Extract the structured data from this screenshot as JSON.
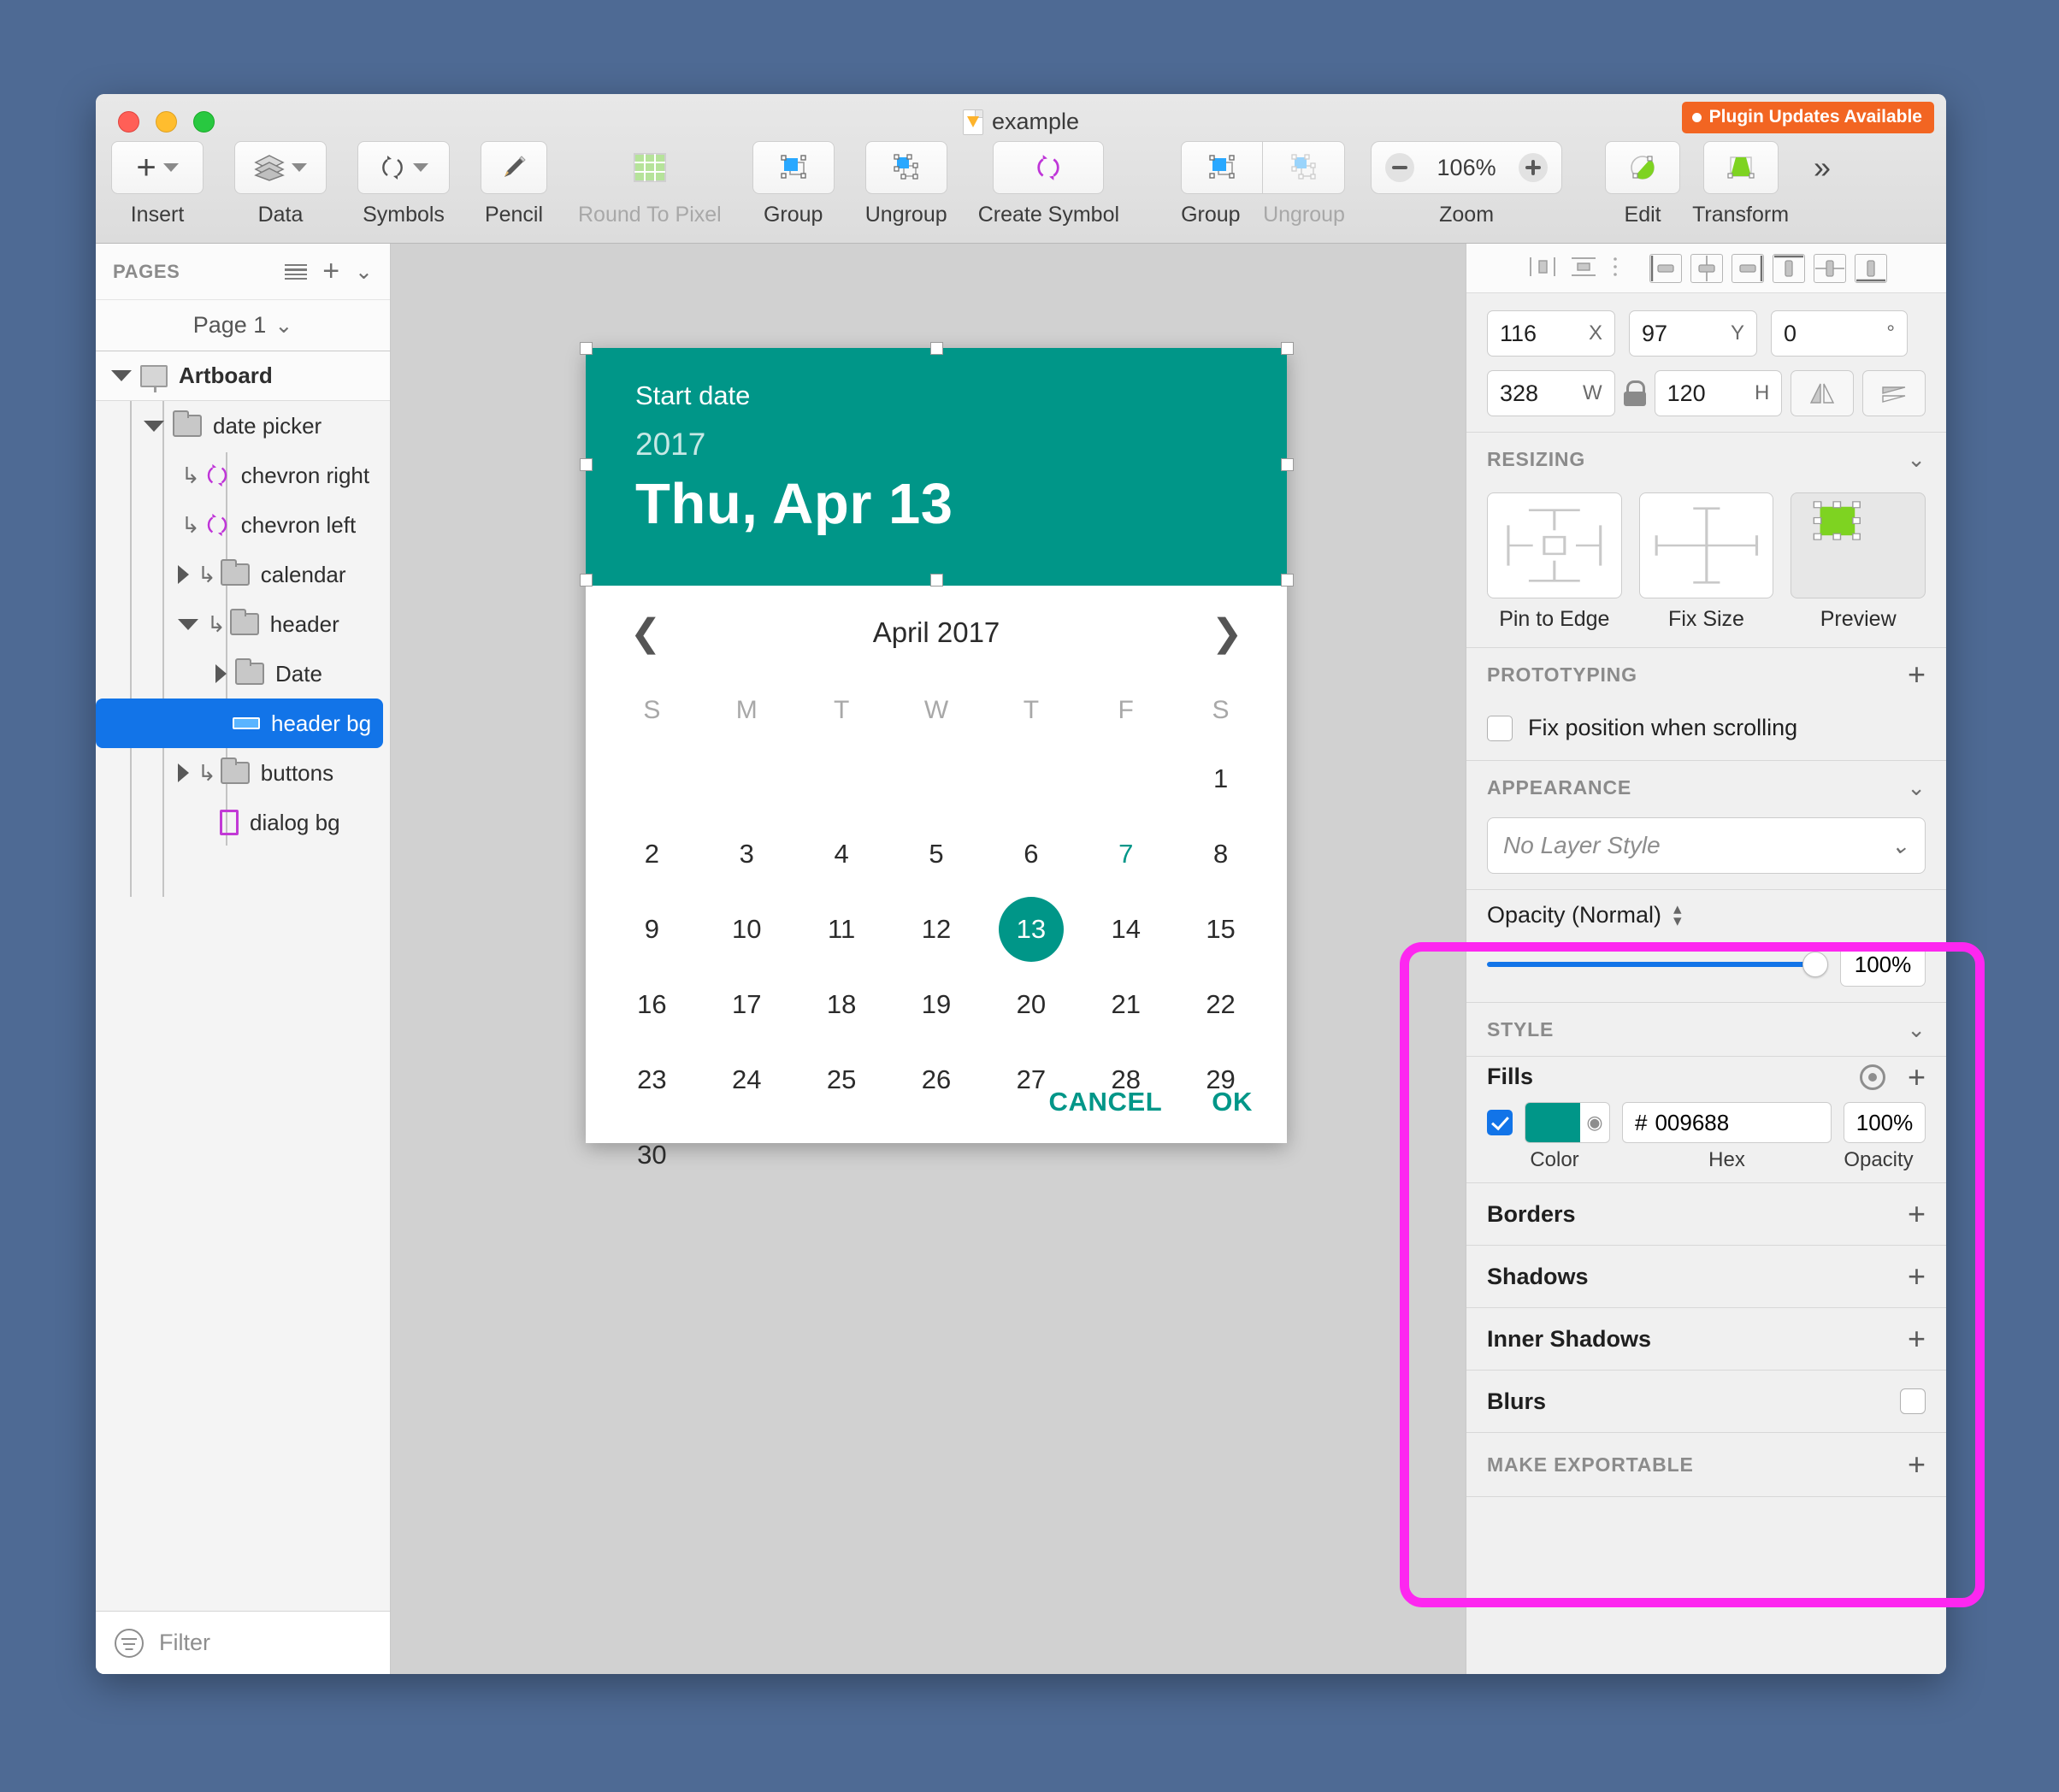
{
  "window": {
    "document_title": "example"
  },
  "plugin_badge": {
    "label": "Plugin Updates Available"
  },
  "toolbar": {
    "items": [
      {
        "label": "Insert",
        "icon": "plus-icon",
        "has_chevron": true
      },
      {
        "label": "Data",
        "icon": "layers-icon",
        "has_chevron": true
      },
      {
        "label": "Symbols",
        "icon": "symbol-icon",
        "has_chevron": true
      },
      {
        "label": "Pencil",
        "icon": "pencil-icon",
        "has_chevron": false
      },
      {
        "label": "Round To Pixel",
        "icon": "grid-icon",
        "has_chevron": false,
        "disabled": true
      },
      {
        "label": "Group",
        "icon": "group-icon",
        "has_chevron": false
      },
      {
        "label": "Ungroup",
        "icon": "ungroup-icon",
        "has_chevron": false
      },
      {
        "label": "Create Symbol",
        "icon": "create-symbol-icon",
        "has_chevron": false
      }
    ],
    "seg_group": "Group",
    "seg_ungroup": "Ungroup",
    "zoom_label": "Zoom",
    "zoom_value": "106%",
    "edit_label": "Edit",
    "transform_label": "Transform",
    "overflow": "»"
  },
  "left_panel": {
    "pages_title": "PAGES",
    "page_name": "Page 1",
    "filter_placeholder": "Filter",
    "layers": [
      {
        "name": "Artboard",
        "indent": 0,
        "disc": "open",
        "icon": "artboard-icon",
        "override": false,
        "selected": false,
        "bold": true
      },
      {
        "name": "date picker",
        "indent": 1,
        "disc": "open",
        "icon": "folder-icon",
        "override": false,
        "selected": false,
        "bold": false
      },
      {
        "name": "chevron right",
        "indent": 2,
        "disc": "none",
        "icon": "symbol-icon",
        "override": true,
        "selected": false,
        "bold": false
      },
      {
        "name": "chevron left",
        "indent": 2,
        "disc": "none",
        "icon": "symbol-icon",
        "override": true,
        "selected": false,
        "bold": false
      },
      {
        "name": "calendar",
        "indent": 2,
        "disc": "closed",
        "icon": "folder-icon",
        "override": true,
        "selected": false,
        "bold": false
      },
      {
        "name": "header",
        "indent": 2,
        "disc": "open",
        "icon": "folder-icon",
        "override": true,
        "selected": false,
        "bold": false
      },
      {
        "name": "Date",
        "indent": 3,
        "disc": "closed",
        "icon": "folder-icon",
        "override": false,
        "selected": false,
        "bold": false
      },
      {
        "name": "header bg",
        "indent": 3,
        "disc": "none",
        "icon": "rectangle-icon",
        "override": false,
        "selected": true,
        "bold": false
      },
      {
        "name": "buttons",
        "indent": 2,
        "disc": "closed",
        "icon": "folder-icon",
        "override": true,
        "selected": false,
        "bold": false
      },
      {
        "name": "dialog bg",
        "indent": 2,
        "disc": "none",
        "icon": "shape-icon",
        "override": false,
        "selected": false,
        "bold": false
      }
    ]
  },
  "canvas": {
    "date_picker": {
      "label": "Start date",
      "year": "2017",
      "date": "Thu, Apr 13",
      "month_title": "April 2017",
      "prev_icon": "chevron-left-icon",
      "next_icon": "chevron-right-icon",
      "dow": [
        "S",
        "M",
        "T",
        "W",
        "T",
        "F",
        "S"
      ],
      "days": [
        "",
        "",
        "",
        "",
        "",
        "",
        "1",
        "2",
        "3",
        "4",
        "5",
        "6",
        "7",
        "8",
        "9",
        "10",
        "11",
        "12",
        "13",
        "14",
        "15",
        "16",
        "17",
        "18",
        "19",
        "20",
        "21",
        "22",
        "23",
        "24",
        "25",
        "26",
        "27",
        "28",
        "29",
        "30",
        "",
        "",
        "",
        "",
        "",
        ""
      ],
      "selected_day": "13",
      "today_day": "7",
      "cancel_label": "CANCEL",
      "ok_label": "OK",
      "accent_color": "#009688"
    }
  },
  "inspector": {
    "position": {
      "x": "116",
      "x_unit": "X",
      "y": "97",
      "y_unit": "Y",
      "rotation": "0",
      "rotation_unit": "°",
      "w": "328",
      "w_unit": "W",
      "h": "120",
      "h_unit": "H"
    },
    "resizing": {
      "title": "RESIZING",
      "options": [
        {
          "label": "Pin to Edge",
          "icon": "pin-to-edge-icon"
        },
        {
          "label": "Fix Size",
          "icon": "fix-size-icon"
        },
        {
          "label": "Preview",
          "icon": "preview-icon"
        }
      ]
    },
    "prototyping": {
      "title": "PROTOTYPING",
      "fix_position_label": "Fix position when scrolling",
      "fix_position_checked": false
    },
    "appearance": {
      "title": "APPEARANCE",
      "layer_style": "No Layer Style"
    },
    "opacity": {
      "label": "Opacity (Normal)",
      "value": "100%",
      "slider_percent": 100
    },
    "style": {
      "title": "STYLE",
      "fills_label": "Fills",
      "fill": {
        "checked": true,
        "color": "#009688",
        "hex": "009688",
        "hex_prefix": "#",
        "opacity": "100%"
      },
      "columns": [
        "Color",
        "Hex",
        "Opacity"
      ],
      "borders_label": "Borders",
      "shadows_label": "Shadows",
      "inner_shadows_label": "Inner Shadows",
      "blurs_label": "Blurs",
      "blurs_checked": false
    },
    "make_exportable": {
      "title": "MAKE EXPORTABLE"
    }
  }
}
